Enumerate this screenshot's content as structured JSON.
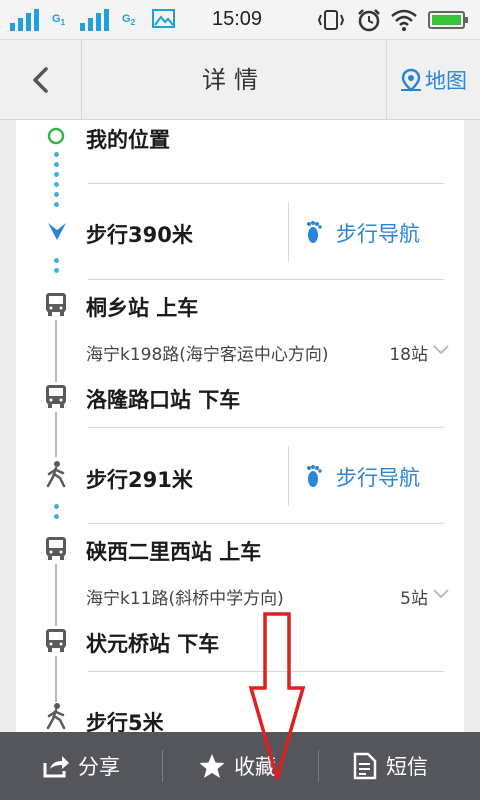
{
  "status_bar": {
    "time": "15:09",
    "sim1": "G",
    "sim1_sub": "1",
    "sim2": "G",
    "sim2_sub": "2"
  },
  "header": {
    "title": "详情",
    "map_label": "地图"
  },
  "route": {
    "start": "我的位置",
    "walk1": {
      "title": "步行390米",
      "nav_label": "步行导航"
    },
    "board1": {
      "title": "桐乡站 上车",
      "line": "海宁k198路(海宁客运中心方向)",
      "stops": "18站"
    },
    "alight1": {
      "title": "洛隆路口站 下车"
    },
    "walk2": {
      "title": "步行291米",
      "nav_label": "步行导航"
    },
    "board2": {
      "title": "硖西二里西站 上车",
      "line": "海宁k11路(斜桥中学方向)",
      "stops": "5站"
    },
    "alight2": {
      "title": "状元桥站 下车"
    },
    "walk3": {
      "title": "步行5米"
    }
  },
  "bottom_bar": {
    "share_label": "分享",
    "favorite_label": "收藏",
    "sms_label": "短信"
  },
  "colors": {
    "accent": "#2a85d8",
    "start_marker": "#3cb54a",
    "dots": "#41b0e6",
    "annotation": "#e02020",
    "bottom_bar": "#54565c"
  }
}
